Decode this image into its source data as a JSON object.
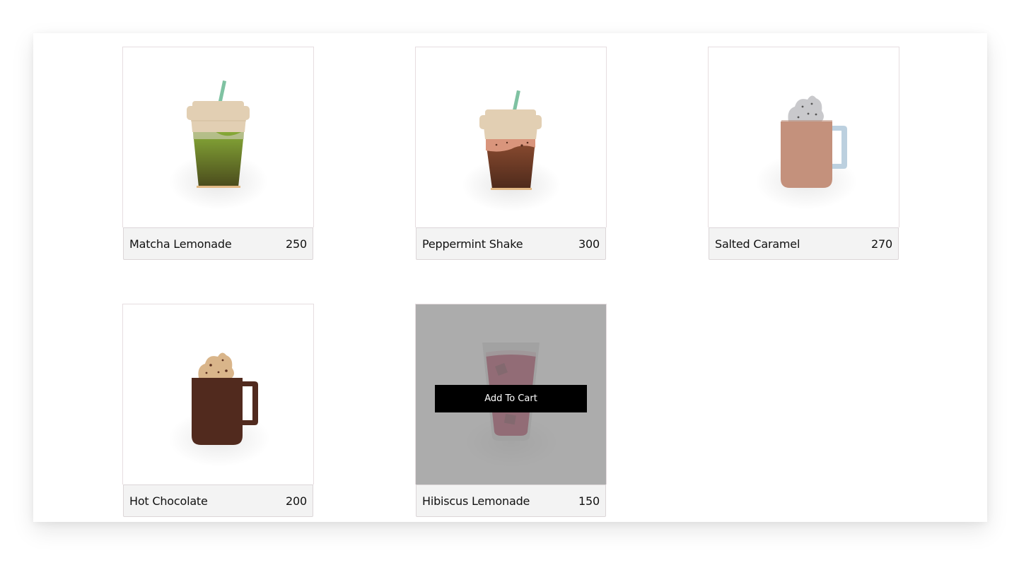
{
  "products": [
    {
      "name": "Matcha Lemonade",
      "price": "250",
      "icon": "matcha-lemonade-cup-icon"
    },
    {
      "name": "Peppermint Shake",
      "price": "300",
      "icon": "peppermint-shake-cup-icon"
    },
    {
      "name": "Salted Caramel",
      "price": "270",
      "icon": "salted-caramel-mug-icon"
    },
    {
      "name": "Hot Chocolate",
      "price": "200",
      "icon": "hot-chocolate-mug-icon"
    },
    {
      "name": "Hibiscus Lemonade",
      "price": "150",
      "icon": "hibiscus-lemonade-glass-icon",
      "hovered": true
    }
  ],
  "actions": {
    "add_to_cart_label": "Add To Cart"
  },
  "colors": {
    "matcha": "#6f8f2c",
    "coffee": "#6b3a26",
    "caramel_mug": "#c4917c",
    "chocolate_mug": "#512a1e",
    "hibiscus": "#a01b3d",
    "lid": "#e2cfb3",
    "straw": "#7fc2a2",
    "button_bg": "#000000"
  }
}
